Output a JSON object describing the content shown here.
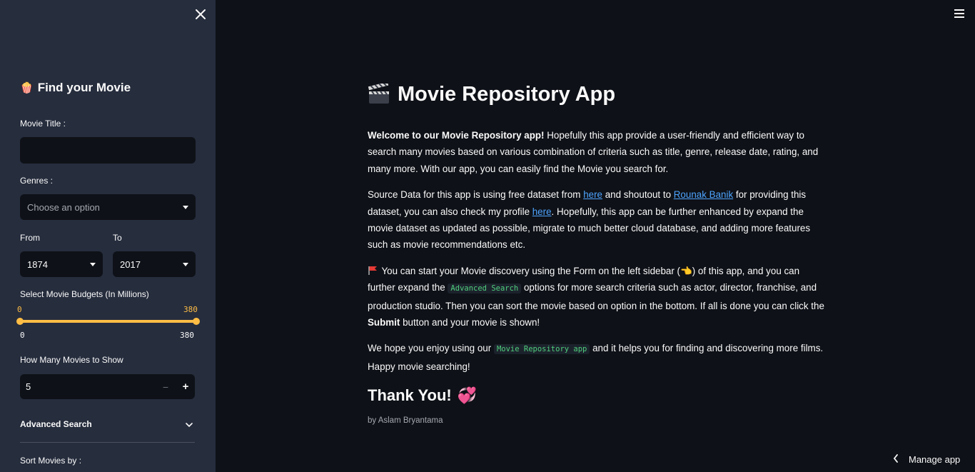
{
  "sidebar": {
    "title": "Find your Movie",
    "title_emoji": "🍿",
    "movie_title_label": "Movie Title :",
    "movie_title_value": "",
    "genres_label": "Genres :",
    "genres_placeholder": "Choose an option",
    "from_label": "From",
    "from_value": "1874",
    "to_label": "To",
    "to_value": "2017",
    "budget_label": "Select Movie Budgets (In Millions)",
    "budget_low": "0",
    "budget_high": "380",
    "budget_min": "0",
    "budget_max": "380",
    "count_label": "How Many Movies to Show",
    "count_value": "5",
    "count_minus": "−",
    "count_plus": "+",
    "advanced_label": "Advanced Search",
    "sort_label": "Sort Movies by :"
  },
  "main": {
    "title": "Movie Repository App",
    "intro_bold": "Welcome to our Movie Repository app!",
    "intro_rest": " Hopefully this app provide a user-friendly and efficient way to search many movies based on various combination of criteria such as title, genre, release date, rating, and many more. With our app, you can easily find the Movie you search for.",
    "source_1": "Source Data for this app is using free dataset from ",
    "source_link1": "here",
    "source_2": " and shoutout to ",
    "source_link2": "Rounak Banik",
    "source_3": " for providing this dataset, you can also check my profile ",
    "source_link3": "here",
    "source_4": ". Hopefully, this app can be further enhanced by expand the movie dataset as updated as possible, migrate to much better cloud database, and adding more features such as movie recommendations etc.",
    "guide_1": " You can start your Movie discovery using the Form on the left sidebar (",
    "guide_emoji": "👈",
    "guide_2": ") of this app, and you can further expand the ",
    "guide_code": "Advanced Search",
    "guide_3": " options for more search criteria such as actor, director, franchise, and production studio. Then you can sort the movie based on option in the bottom. If all is done you can click the ",
    "guide_bold": "Submit",
    "guide_4": " button and your movie is shown!",
    "hope_1": "We hope you enjoy using our ",
    "hope_code": "Movie Repository app",
    "hope_2": " and it helps you for finding and discovering more films. Happy movie searching!",
    "thanks": "Thank You!",
    "thanks_emoji": "💞",
    "author": "by Aslam Bryantama"
  },
  "manage_app": "Manage app",
  "colors": {
    "background": "#0e1117",
    "sidebar": "#262d3d",
    "accent": "#ffbd45",
    "link": "#4ea4ff",
    "code": "#4fcf7d"
  }
}
